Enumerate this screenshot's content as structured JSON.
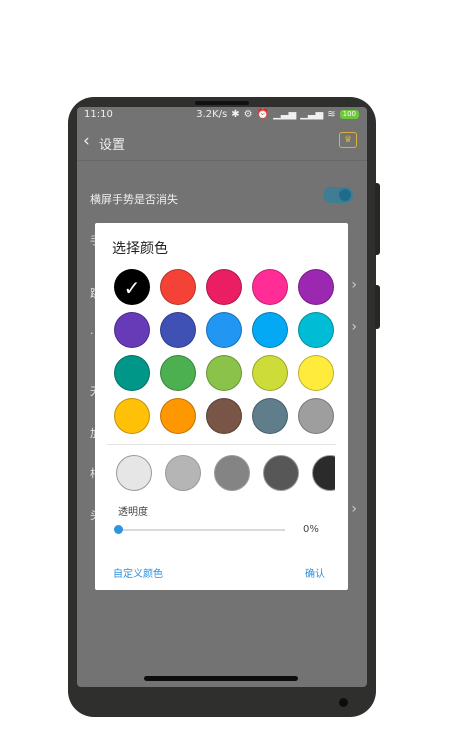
{
  "status_bar": {
    "time": "11:10",
    "speed": "3.2K/s",
    "icons": [
      "bluetooth-icon",
      "gear-icon",
      "alarm-icon",
      "signal-icon",
      "signal-icon",
      "wifi-icon"
    ],
    "battery": "100"
  },
  "header": {
    "title": "设置",
    "back_icon": "back-chevron-icon",
    "vip_icon": "vip-crown-icon"
  },
  "background_settings": {
    "row1": "横屏手势是否消失",
    "toggle_on": true
  },
  "background_partial": [
    "手",
    "跳",
    "·",
    "无",
    "加",
    "相",
    "头"
  ],
  "dialog": {
    "title": "选择颜色",
    "colors": [
      [
        "#000000",
        "#f44336",
        "#e91e63",
        "#ff2d95",
        "#9c27b0"
      ],
      [
        "#673ab7",
        "#3f51b5",
        "#2196f3",
        "#03a9f4",
        "#00bcd4"
      ],
      [
        "#009688",
        "#4caf50",
        "#8bc34a",
        "#cddc39",
        "#ffeb3b"
      ],
      [
        "#ffc107",
        "#ff9800",
        "#795548",
        "#607d8b",
        "#9e9e9e"
      ]
    ],
    "selected_color": "#000000",
    "grays": [
      "#e6e6e6",
      "#b5b5b5",
      "#848484",
      "#575757",
      "#2b2b2b"
    ],
    "opacity_label": "透明度",
    "opacity_value": "0%",
    "opacity_fraction": 0,
    "custom_label": "自定义颜色",
    "confirm_label": "确认"
  }
}
